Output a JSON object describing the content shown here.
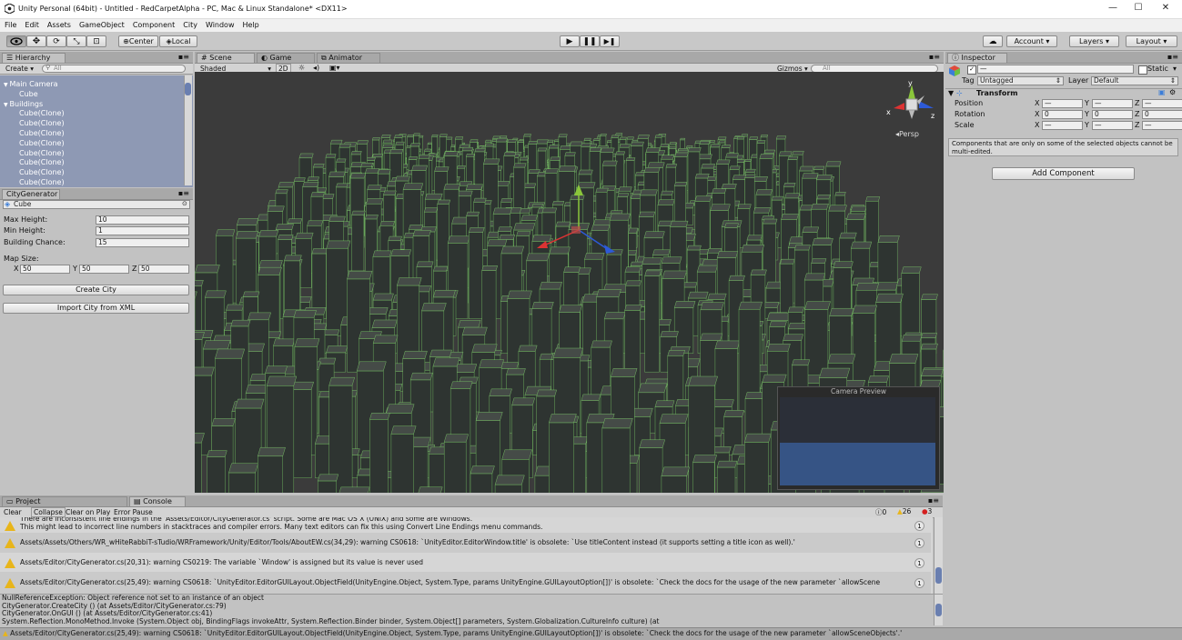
{
  "window": {
    "title": "Unity Personal (64bit) - Untitled - RedCarpetAlpha - PC, Mac & Linux Standalone* <DX11>",
    "minimize": "—",
    "maximize": "☐",
    "close": "✕"
  },
  "menu": [
    "File",
    "Edit",
    "Assets",
    "GameObject",
    "Component",
    "City",
    "Window",
    "Help"
  ],
  "toolbar": {
    "pivot": "Center",
    "space": "Local",
    "account": "Account",
    "layers": "Layers",
    "layout": "Layout"
  },
  "hierarchy": {
    "tab": "Hierarchy",
    "create": "Create",
    "search_placeholder": "All",
    "items": [
      {
        "label": "Main Camera",
        "indent": 0,
        "arrow": "▼"
      },
      {
        "label": "Cube",
        "indent": 1,
        "arrow": ""
      },
      {
        "label": "Buildings",
        "indent": 0,
        "arrow": "▼"
      },
      {
        "label": "Cube(Clone)",
        "indent": 1,
        "arrow": ""
      },
      {
        "label": "Cube(Clone)",
        "indent": 1,
        "arrow": ""
      },
      {
        "label": "Cube(Clone)",
        "indent": 1,
        "arrow": ""
      },
      {
        "label": "Cube(Clone)",
        "indent": 1,
        "arrow": ""
      },
      {
        "label": "Cube(Clone)",
        "indent": 1,
        "arrow": ""
      },
      {
        "label": "Cube(Clone)",
        "indent": 1,
        "arrow": ""
      },
      {
        "label": "Cube(Clone)",
        "indent": 1,
        "arrow": ""
      },
      {
        "label": "Cube(Clone)",
        "indent": 1,
        "arrow": ""
      }
    ]
  },
  "citygen": {
    "tab": "CityGenerator",
    "object_field": "Cube",
    "max_height_label": "Max Height:",
    "max_height": "10",
    "min_height_label": "Min Height:",
    "min_height": "1",
    "chance_label": "Building Chance:",
    "chance": "15",
    "map_size_label": "Map Size:",
    "x_label": "X",
    "x": "50",
    "y_label": "Y",
    "y": "50",
    "z_label": "Z",
    "z": "50",
    "create_button": "Create City",
    "import_button": "Import City from XML"
  },
  "scene": {
    "tabs": [
      "Scene",
      "Game",
      "Animator"
    ],
    "shading": "Shaded",
    "mode_2d": "2D",
    "gizmos": "Gizmos",
    "search_placeholder": "All",
    "persp": "Persp",
    "axis_x": "x",
    "axis_y": "y",
    "axis_z": "z",
    "camera_preview": "Camera Preview"
  },
  "inspector": {
    "tab": "Inspector",
    "name_placeholder": "—",
    "static_label": "Static",
    "tag_label": "Tag",
    "tag_value": "Untagged",
    "layer_label": "Layer",
    "layer_value": "Default",
    "transform_title": "Transform",
    "position_label": "Position",
    "rotation_label": "Rotation",
    "scale_label": "Scale",
    "position": {
      "x": "—",
      "y": "—",
      "z": "—"
    },
    "rotation": {
      "x": "0",
      "y": "0",
      "z": "0"
    },
    "scale": {
      "x": "—",
      "y": "—",
      "z": "—"
    },
    "axis_x": "X",
    "axis_y": "Y",
    "axis_z": "Z",
    "note": "Components that are only on some of the selected objects cannot be multi-edited.",
    "add_component": "Add Component"
  },
  "console": {
    "project_tab": "Project",
    "console_tab": "Console",
    "buttons": [
      "Clear",
      "Collapse",
      "Clear on Play",
      "Error Pause"
    ],
    "info_count": "0",
    "warn_count": "26",
    "error_count": "3",
    "entries": [
      {
        "line1": "There are inconsistent line endings in the 'Assets/Editor/CityGenerator.cs' script. Some are Mac OS X (UNIX) and some are Windows.",
        "line2": "This might lead to incorrect line numbers in stacktraces and compiler errors. Many text editors can fix this using Convert Line Endings menu commands.",
        "count": "1"
      },
      {
        "line1": "Assets/Assets/Others/WR_wHiteRabbiT-sTudio/WRFramework/Unity/Editor/Tools/AboutEW.cs(34,29): warning CS0618: `UnityEditor.EditorWindow.title' is obsolete: `Use titleContent instead (it supports setting a title icon as well).'",
        "line2": "",
        "count": "1"
      },
      {
        "line1": "Assets/Editor/CityGenerator.cs(20,31): warning CS0219: The variable `Window' is assigned but its value is never used",
        "line2": "",
        "count": "1"
      },
      {
        "line1": "Assets/Editor/CityGenerator.cs(25,49): warning CS0618: `UnityEditor.EditorGUILayout.ObjectField(UnityEngine.Object, System.Type, params UnityEngine.GUILayoutOption[])' is obsolete: `Check the docs for the usage of the new parameter `allowScene",
        "line2": "",
        "count": "1"
      }
    ],
    "detail": [
      "NullReferenceException: Object reference not set to an instance of an object",
      "CityGenerator.CreateCity () (at Assets/Editor/CityGenerator.cs:79)",
      "CityGenerator.OnGUI () (at Assets/Editor/CityGenerator.cs:41)",
      "System.Reflection.MonoMethod.Invoke (System.Object obj, BindingFlags invokeAttr, System.Reflection.Binder binder, System.Object[] parameters, System.Globalization.CultureInfo culture) (at"
    ]
  },
  "status": {
    "message": "Assets/Editor/CityGenerator.cs(25,49): warning CS0618: `UnityEditor.EditorGUILayout.ObjectField(UnityEngine.Object, System.Type, params UnityEngine.GUILayoutOption[])' is obsolete: `Check the docs for the usage of the new parameter `allowSceneObjects'.'"
  },
  "colors": {
    "selection": "#8e99b4",
    "scene_bg": "#3a3a3a",
    "wire": "#7fd26a",
    "warning": "#e8b51a",
    "error": "#d42020"
  }
}
